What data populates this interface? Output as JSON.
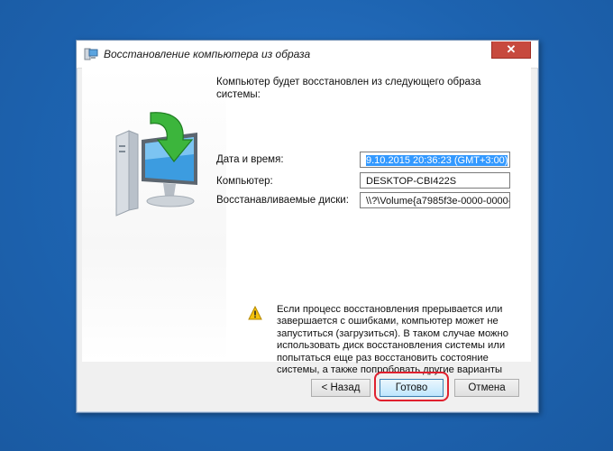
{
  "window": {
    "title": "Восстановление компьютера из образа",
    "close_glyph": "✕"
  },
  "intro_text": "Компьютер будет восстановлен из следующего образа системы:",
  "fields": [
    {
      "label": "Дата и время:",
      "value": "9.10.2015 20:36:23 (GMT+3:00)"
    },
    {
      "label": "Компьютер:",
      "value": "DESKTOP-CBI422S"
    },
    {
      "label": "Восстанавливаемые диски:",
      "value": "\\\\?\\Volume{a7985f3e-0000-0000-"
    }
  ],
  "warning_text": "Если процесс восстановления прерывается или завершается с ошибками, компьютер может не запуститься (загрузиться). В таком случае можно использовать диск восстановления системы или попытаться еще раз восстановить состояние системы, а также попробовать другие варианты",
  "buttons": {
    "back": "< Назад",
    "finish": "Готово",
    "cancel": "Отмена"
  },
  "icons": {
    "title": "restore-computer-icon",
    "illustration": "computer-restore-illustration",
    "warning": "warning-icon"
  },
  "colors": {
    "desktop": "#1f66b4",
    "highlight": "#e0202e",
    "close": "#c74a3e"
  }
}
